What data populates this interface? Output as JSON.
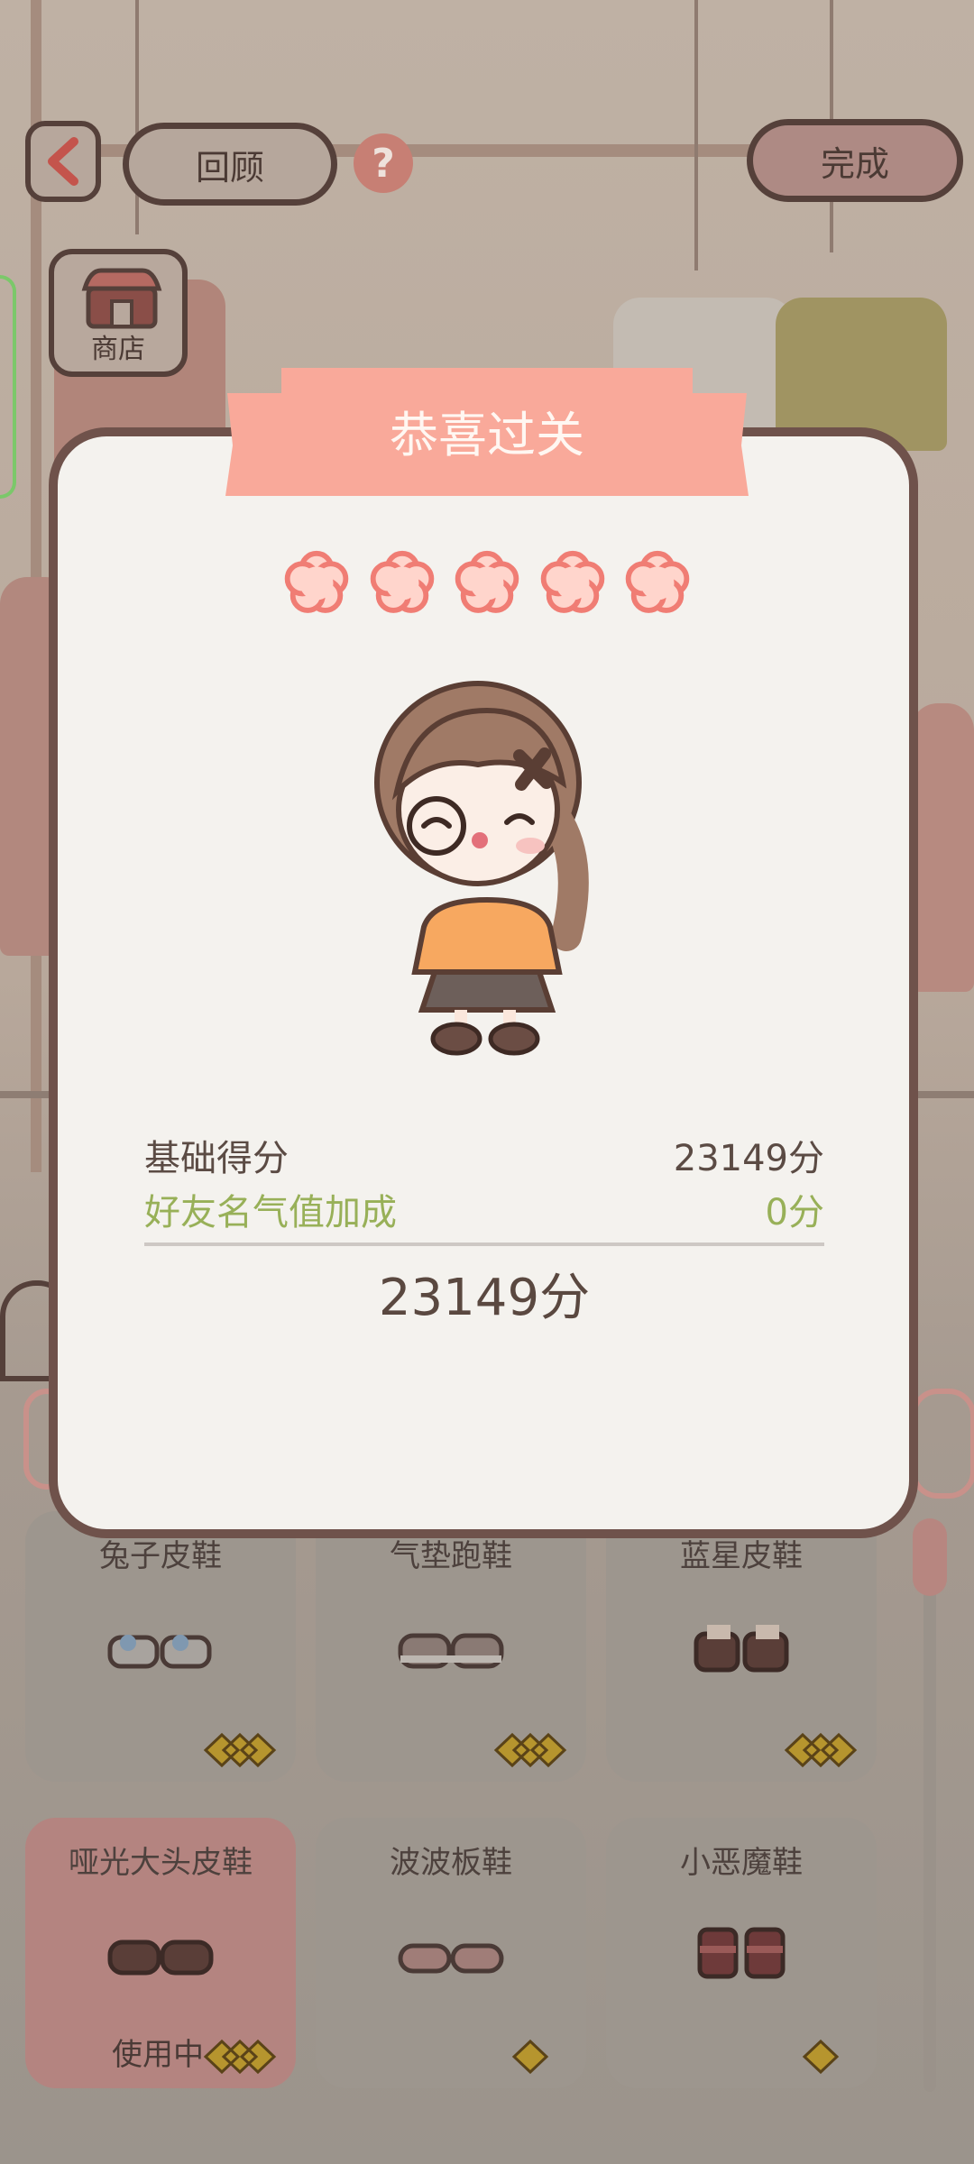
{
  "topbar": {
    "back_icon": "chevron-left-icon",
    "review_label": "回顾",
    "help_glyph": "?",
    "done_label": "完成"
  },
  "shop": {
    "label": "商店",
    "icon": "shop-icon"
  },
  "dialog": {
    "title": "恭喜过关",
    "stars_earned": 5,
    "stars_total": 5,
    "base_score_label": "基础得分",
    "base_score_value": "23149分",
    "bonus_label": "好友名气值加成",
    "bonus_value": "0分",
    "total_value": "23149分"
  },
  "items": [
    {
      "name": "兔子皮鞋",
      "status": ""
    },
    {
      "name": "气垫跑鞋",
      "status": ""
    },
    {
      "name": "蓝星皮鞋",
      "status": ""
    },
    {
      "name": "哑光大头皮鞋",
      "status": "使用中"
    },
    {
      "name": "波波板鞋",
      "status": ""
    },
    {
      "name": "小恶魔鞋",
      "status": ""
    }
  ],
  "colors": {
    "ribbon": "#f9a99a",
    "star_fill": "#ffd5cc",
    "star_outline": "#f07d74",
    "dialog_border": "#6f524b",
    "bonus_text": "#98b058"
  }
}
